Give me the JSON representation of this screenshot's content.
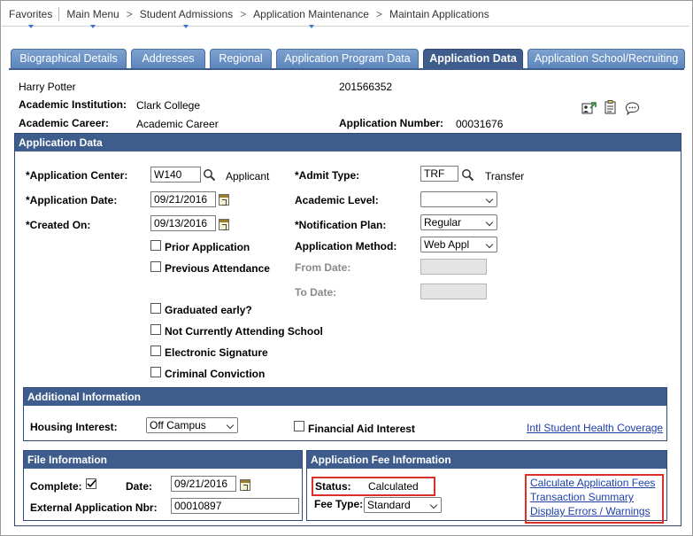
{
  "breadcrumb": {
    "items": [
      "Favorites",
      "Main Menu",
      "Student Admissions",
      "Application Maintenance",
      "Maintain Applications"
    ]
  },
  "tabs": [
    {
      "label": "Biographical Details"
    },
    {
      "label": "Addresses"
    },
    {
      "label": "Regional"
    },
    {
      "label": "Application Program Data"
    },
    {
      "label": "Application Data"
    },
    {
      "label": "Application School/Recruiting"
    }
  ],
  "header": {
    "name": "Harry Potter",
    "id": "201566352",
    "institution_label": "Academic Institution:",
    "institution_value": "Clark College",
    "career_label": "Academic Career:",
    "career_value": "Academic Career",
    "app_number_label": "Application Number:",
    "app_number_value": "00031676"
  },
  "app_data": {
    "title": "Application Data",
    "app_center_label": "*Application Center:",
    "app_center_value": "W140",
    "app_center_desc": "Applicant",
    "app_date_label": "*Application Date:",
    "app_date_value": "09/21/2016",
    "created_on_label": "*Created On:",
    "created_on_value": "09/13/2016",
    "admit_type_label": "*Admit Type:",
    "admit_type_value": "TRF",
    "admit_type_desc": "Transfer",
    "academic_level_label": "Academic Level:",
    "academic_level_value": "",
    "notification_plan_label": "*Notification Plan:",
    "notification_plan_value": "Regular",
    "app_method_label": "Application Method:",
    "app_method_value": "Web Appl",
    "from_date_label": "From Date:",
    "to_date_label": "To Date:",
    "checkboxes": {
      "prior_application": "Prior Application",
      "previous_attendance": "Previous Attendance",
      "graduated_early": "Graduated early?",
      "not_attending": "Not Currently Attending School",
      "electronic_signature": "Electronic Signature",
      "criminal_conviction": "Criminal Conviction"
    }
  },
  "additional_info": {
    "title": "Additional Information",
    "housing_label": "Housing Interest:",
    "housing_value": "Off Campus",
    "fin_aid_label": "Financial Aid Interest",
    "intl_link": "Intl Student Health Coverage"
  },
  "file_info": {
    "title": "File Information",
    "complete_label": "Complete:",
    "date_label": "Date:",
    "date_value": "09/21/2016",
    "ext_app_label": "External Application Nbr:",
    "ext_app_value": "00010897"
  },
  "fee_info": {
    "title": "Application Fee Information",
    "status_label": "Status:",
    "status_value": "Calculated",
    "fee_type_label": "Fee Type:",
    "fee_type_value": "Standard",
    "links": [
      "Calculate Application Fees",
      "Transaction Summary",
      "Display Errors / Warnings"
    ]
  },
  "colors": {
    "section_header": "#3f5d8c",
    "tab": "#6b8fc4",
    "link": "#1d3fa8",
    "highlight": "#d9302a"
  }
}
